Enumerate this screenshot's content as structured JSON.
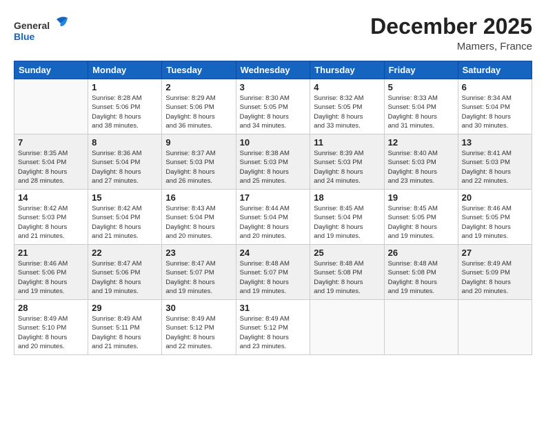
{
  "header": {
    "logo_line1": "General",
    "logo_line2": "Blue",
    "month_title": "December 2025",
    "location": "Mamers, France"
  },
  "weekdays": [
    "Sunday",
    "Monday",
    "Tuesday",
    "Wednesday",
    "Thursday",
    "Friday",
    "Saturday"
  ],
  "weeks": [
    [
      {
        "day": "",
        "info": ""
      },
      {
        "day": "1",
        "info": "Sunrise: 8:28 AM\nSunset: 5:06 PM\nDaylight: 8 hours\nand 38 minutes."
      },
      {
        "day": "2",
        "info": "Sunrise: 8:29 AM\nSunset: 5:06 PM\nDaylight: 8 hours\nand 36 minutes."
      },
      {
        "day": "3",
        "info": "Sunrise: 8:30 AM\nSunset: 5:05 PM\nDaylight: 8 hours\nand 34 minutes."
      },
      {
        "day": "4",
        "info": "Sunrise: 8:32 AM\nSunset: 5:05 PM\nDaylight: 8 hours\nand 33 minutes."
      },
      {
        "day": "5",
        "info": "Sunrise: 8:33 AM\nSunset: 5:04 PM\nDaylight: 8 hours\nand 31 minutes."
      },
      {
        "day": "6",
        "info": "Sunrise: 8:34 AM\nSunset: 5:04 PM\nDaylight: 8 hours\nand 30 minutes."
      }
    ],
    [
      {
        "day": "7",
        "info": "Sunrise: 8:35 AM\nSunset: 5:04 PM\nDaylight: 8 hours\nand 28 minutes."
      },
      {
        "day": "8",
        "info": "Sunrise: 8:36 AM\nSunset: 5:04 PM\nDaylight: 8 hours\nand 27 minutes."
      },
      {
        "day": "9",
        "info": "Sunrise: 8:37 AM\nSunset: 5:03 PM\nDaylight: 8 hours\nand 26 minutes."
      },
      {
        "day": "10",
        "info": "Sunrise: 8:38 AM\nSunset: 5:03 PM\nDaylight: 8 hours\nand 25 minutes."
      },
      {
        "day": "11",
        "info": "Sunrise: 8:39 AM\nSunset: 5:03 PM\nDaylight: 8 hours\nand 24 minutes."
      },
      {
        "day": "12",
        "info": "Sunrise: 8:40 AM\nSunset: 5:03 PM\nDaylight: 8 hours\nand 23 minutes."
      },
      {
        "day": "13",
        "info": "Sunrise: 8:41 AM\nSunset: 5:03 PM\nDaylight: 8 hours\nand 22 minutes."
      }
    ],
    [
      {
        "day": "14",
        "info": "Sunrise: 8:42 AM\nSunset: 5:03 PM\nDaylight: 8 hours\nand 21 minutes."
      },
      {
        "day": "15",
        "info": "Sunrise: 8:42 AM\nSunset: 5:04 PM\nDaylight: 8 hours\nand 21 minutes."
      },
      {
        "day": "16",
        "info": "Sunrise: 8:43 AM\nSunset: 5:04 PM\nDaylight: 8 hours\nand 20 minutes."
      },
      {
        "day": "17",
        "info": "Sunrise: 8:44 AM\nSunset: 5:04 PM\nDaylight: 8 hours\nand 20 minutes."
      },
      {
        "day": "18",
        "info": "Sunrise: 8:45 AM\nSunset: 5:04 PM\nDaylight: 8 hours\nand 19 minutes."
      },
      {
        "day": "19",
        "info": "Sunrise: 8:45 AM\nSunset: 5:05 PM\nDaylight: 8 hours\nand 19 minutes."
      },
      {
        "day": "20",
        "info": "Sunrise: 8:46 AM\nSunset: 5:05 PM\nDaylight: 8 hours\nand 19 minutes."
      }
    ],
    [
      {
        "day": "21",
        "info": "Sunrise: 8:46 AM\nSunset: 5:06 PM\nDaylight: 8 hours\nand 19 minutes."
      },
      {
        "day": "22",
        "info": "Sunrise: 8:47 AM\nSunset: 5:06 PM\nDaylight: 8 hours\nand 19 minutes."
      },
      {
        "day": "23",
        "info": "Sunrise: 8:47 AM\nSunset: 5:07 PM\nDaylight: 8 hours\nand 19 minutes."
      },
      {
        "day": "24",
        "info": "Sunrise: 8:48 AM\nSunset: 5:07 PM\nDaylight: 8 hours\nand 19 minutes."
      },
      {
        "day": "25",
        "info": "Sunrise: 8:48 AM\nSunset: 5:08 PM\nDaylight: 8 hours\nand 19 minutes."
      },
      {
        "day": "26",
        "info": "Sunrise: 8:48 AM\nSunset: 5:08 PM\nDaylight: 8 hours\nand 19 minutes."
      },
      {
        "day": "27",
        "info": "Sunrise: 8:49 AM\nSunset: 5:09 PM\nDaylight: 8 hours\nand 20 minutes."
      }
    ],
    [
      {
        "day": "28",
        "info": "Sunrise: 8:49 AM\nSunset: 5:10 PM\nDaylight: 8 hours\nand 20 minutes."
      },
      {
        "day": "29",
        "info": "Sunrise: 8:49 AM\nSunset: 5:11 PM\nDaylight: 8 hours\nand 21 minutes."
      },
      {
        "day": "30",
        "info": "Sunrise: 8:49 AM\nSunset: 5:12 PM\nDaylight: 8 hours\nand 22 minutes."
      },
      {
        "day": "31",
        "info": "Sunrise: 8:49 AM\nSunset: 5:12 PM\nDaylight: 8 hours\nand 23 minutes."
      },
      {
        "day": "",
        "info": ""
      },
      {
        "day": "",
        "info": ""
      },
      {
        "day": "",
        "info": ""
      }
    ]
  ]
}
